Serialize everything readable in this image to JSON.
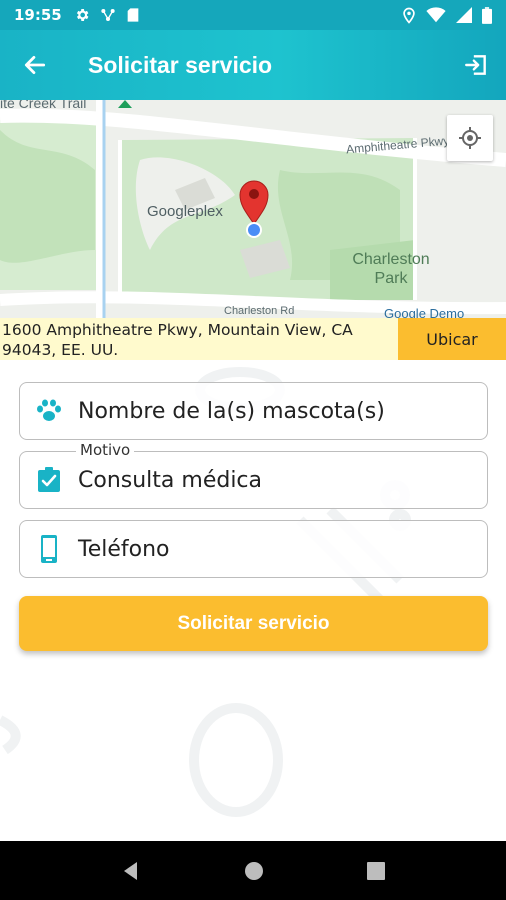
{
  "status_bar": {
    "time": "19:55",
    "icons": [
      "settings-icon",
      "network-share-icon",
      "sd-card-icon",
      "location-icon",
      "wifi-icon",
      "signal-icon",
      "battery-icon"
    ]
  },
  "app_bar": {
    "title": "Solicitar servicio",
    "back_icon": "arrow-left-icon",
    "exit_icon": "exit-icon"
  },
  "map": {
    "labels": {
      "trail": "ite Creek Trail",
      "parkway": "Amphitheatre Pkwy",
      "googleplex": "Googleplex",
      "charleston_park": "Charleston Park",
      "charleston_rd": "Charleston Rd",
      "google_demo": "Google Demo"
    },
    "locate_icon": "my-location-icon"
  },
  "address": {
    "text": "1600 Amphitheatre Pkwy, Mountain View, CA 94043, EE. UU.",
    "button_label": "Ubicar"
  },
  "form": {
    "pets": {
      "placeholder": "Nombre de la(s) mascota(s)",
      "icon": "paw-icon"
    },
    "reason": {
      "legend": "Motivo",
      "value": "Consulta médica",
      "icon": "clipboard-check-icon"
    },
    "phone": {
      "placeholder": "Teléfono",
      "icon": "phone-icon"
    },
    "submit_label": "Solicitar servicio"
  },
  "colors": {
    "primary": "#19b3c6",
    "accent": "#fbbd2f",
    "address_bg": "#fffacd",
    "map_park": "#c8e6c0"
  }
}
